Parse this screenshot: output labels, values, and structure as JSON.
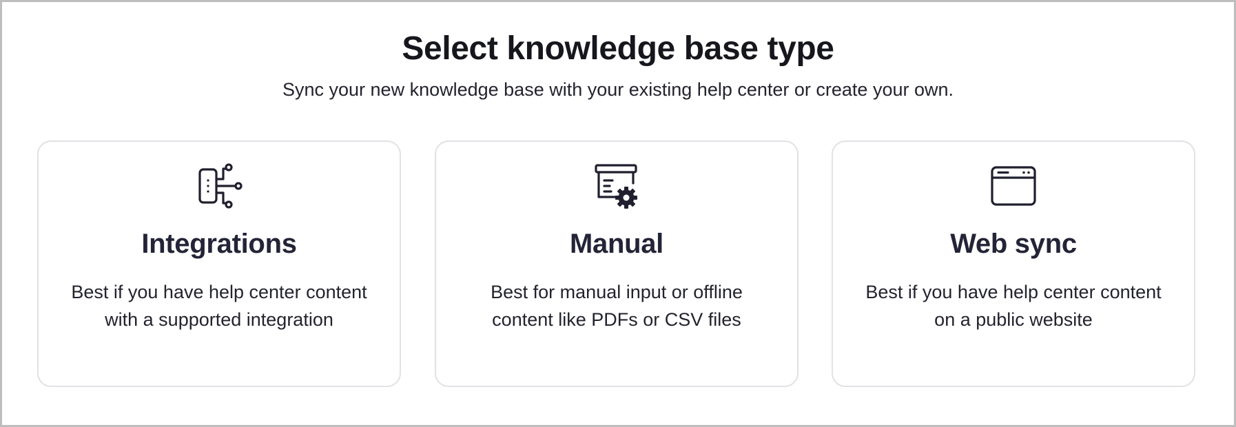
{
  "header": {
    "title": "Select knowledge base type",
    "subtitle": "Sync your new knowledge base with your existing help center or create your own."
  },
  "options": [
    {
      "icon": "integrations-icon",
      "title": "Integrations",
      "description_line1": "Best if you have help center content",
      "description_line2": "with a supported integration"
    },
    {
      "icon": "manual-document-gear-icon",
      "title": "Manual",
      "description_line1": "Best for manual input or offline",
      "description_line2": "content like PDFs or CSV files"
    },
    {
      "icon": "browser-window-icon",
      "title": "Web sync",
      "description_line1": "Best if you have help center content",
      "description_line2": "on a public website"
    }
  ],
  "colors": {
    "text": "#242438",
    "card_border": "#e1e1e6",
    "frame_border": "#bdbdbd"
  }
}
